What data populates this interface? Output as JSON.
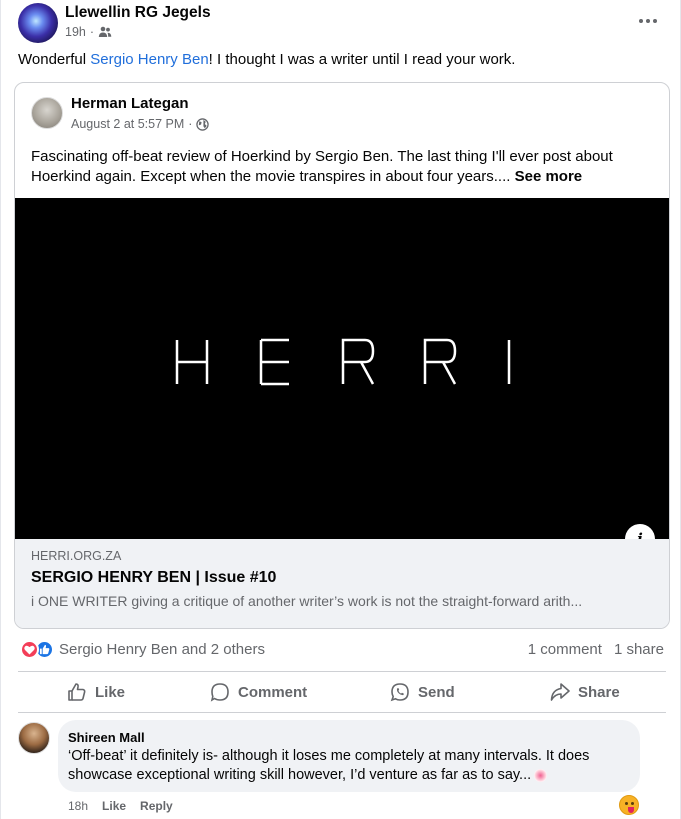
{
  "post": {
    "author": "Llewellin RG Jegels",
    "time": "19h",
    "time_separator": "·",
    "text_prefix": "Wonderful ",
    "mention": "Sergio Henry Ben",
    "text_suffix": "! I thought I was a writer until I read your work."
  },
  "shared": {
    "author": "Herman Lategan",
    "time": "August 2 at 5:57 PM",
    "time_separator": "·",
    "text": "Fascinating off-beat review of Hoerkind by Sergio Ben. The last thing I'll ever post about Hoerkind again. Except when the movie transpires in about four years....",
    "see_more": "See more",
    "link": {
      "domain": "HERRI.ORG.ZA",
      "title": "SERGIO HENRY BEN | Issue #10",
      "description": "i ONE WRITER giving a critique of another writer’s work is not the straight-forward arith...",
      "info_glyph": "i"
    }
  },
  "reactions": {
    "summary": "Sergio Henry Ben and 2 others",
    "comments": "1 comment",
    "shares": "1 share",
    "colors": {
      "love": "#f33e58",
      "like": "#1b74e4"
    }
  },
  "actions": {
    "like": "Like",
    "comment": "Comment",
    "send": "Send",
    "share": "Share"
  },
  "comment": {
    "author": "Shireen Mall",
    "text": "‘Off-beat’ it definitely is- although it loses me completely at many intervals. It does showcase exceptional writing skill however, I’d venture as far as to say...",
    "time": "18h",
    "like": "Like",
    "reply": "Reply"
  },
  "colors": {
    "mention": "#216fdb",
    "muted": "#65676b"
  }
}
